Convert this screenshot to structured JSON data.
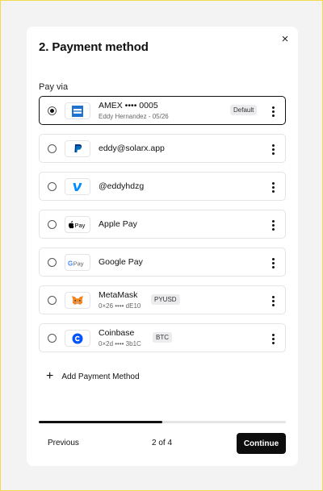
{
  "modal": {
    "title": "2. Payment method",
    "close_label": "×",
    "pay_via_label": "Pay via"
  },
  "methods": [
    {
      "name": "AMEX •••• 0005",
      "sub": "Eddy Hernandez - 05/26",
      "badge": "Default",
      "selected": true,
      "icon": "amex-icon"
    },
    {
      "name": "eddy@solarx.app",
      "sub": "",
      "badge": "",
      "selected": false,
      "icon": "paypal-icon"
    },
    {
      "name": "@eddyhdzg",
      "sub": "",
      "badge": "",
      "selected": false,
      "icon": "venmo-icon"
    },
    {
      "name": "Apple Pay",
      "sub": "",
      "badge": "",
      "selected": false,
      "icon": "apple-pay-icon"
    },
    {
      "name": "Google Pay",
      "sub": "",
      "badge": "",
      "selected": false,
      "icon": "google-pay-icon"
    },
    {
      "name": "MetaMask",
      "sub": "0×26 •••• dE10",
      "badge": "PYUSD",
      "selected": false,
      "icon": "metamask-icon"
    },
    {
      "name": "Coinbase",
      "sub": "0×2d •••• 3b1C",
      "badge": "BTC",
      "selected": false,
      "icon": "coinbase-icon"
    }
  ],
  "add_method": {
    "label": "Add Payment Method",
    "icon": "plus-icon"
  },
  "footer": {
    "previous_label": "Previous",
    "step_text": "2 of 4",
    "progress": 0.5,
    "continue_label": "Continue"
  },
  "colors": {
    "accent": "#0d0d0d",
    "amex": "#1f72cd",
    "paypal": "#003087",
    "venmo": "#008cff",
    "coinbase": "#0052ff",
    "metamask": "#e2761b"
  }
}
